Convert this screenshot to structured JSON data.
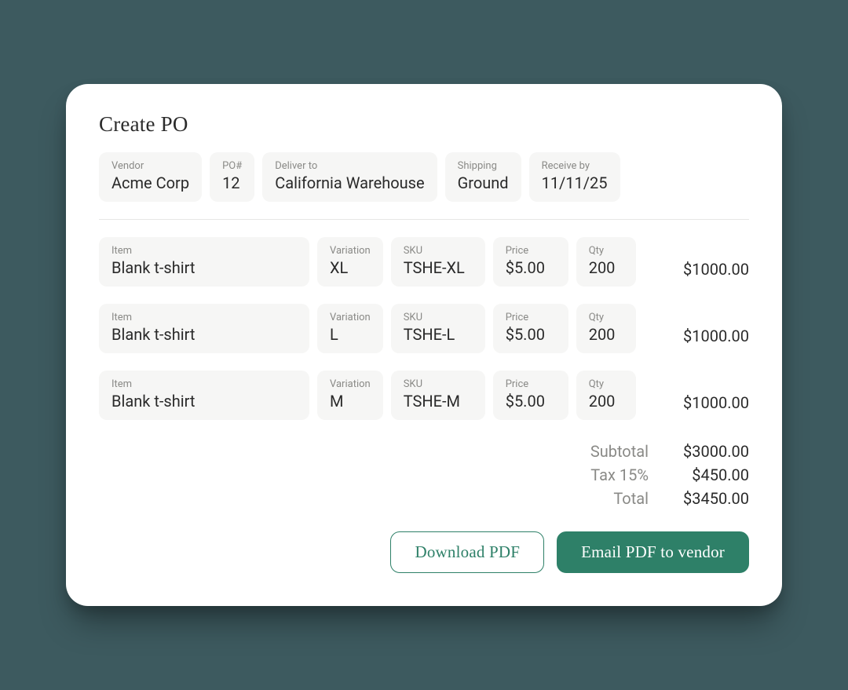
{
  "title": "Create PO",
  "header": {
    "vendor_label": "Vendor",
    "vendor_value": "Acme Corp",
    "po_label": "PO#",
    "po_value": "12",
    "deliver_label": "Deliver to",
    "deliver_value": "California Warehouse",
    "shipping_label": "Shipping",
    "shipping_value": "Ground",
    "receive_label": "Receive by",
    "receive_value": "11/11/25"
  },
  "labels": {
    "item": "Item",
    "variation": "Variation",
    "sku": "SKU",
    "price": "Price",
    "qty": "Qty"
  },
  "items": [
    {
      "item": "Blank t-shirt",
      "variation": "XL",
      "sku": "TSHE-XL",
      "price": "$5.00",
      "qty": "200",
      "total": "$1000.00"
    },
    {
      "item": "Blank t-shirt",
      "variation": "L",
      "sku": "TSHE-L",
      "price": "$5.00",
      "qty": "200",
      "total": "$1000.00"
    },
    {
      "item": "Blank t-shirt",
      "variation": "M",
      "sku": "TSHE-M",
      "price": "$5.00",
      "qty": "200",
      "total": "$1000.00"
    }
  ],
  "totals": {
    "subtotal_label": "Subtotal",
    "subtotal_value": "$3000.00",
    "tax_label": "Tax 15%",
    "tax_value": "$450.00",
    "total_label": "Total",
    "total_value": "$3450.00"
  },
  "actions": {
    "download": "Download PDF",
    "email": "Email PDF to vendor"
  }
}
